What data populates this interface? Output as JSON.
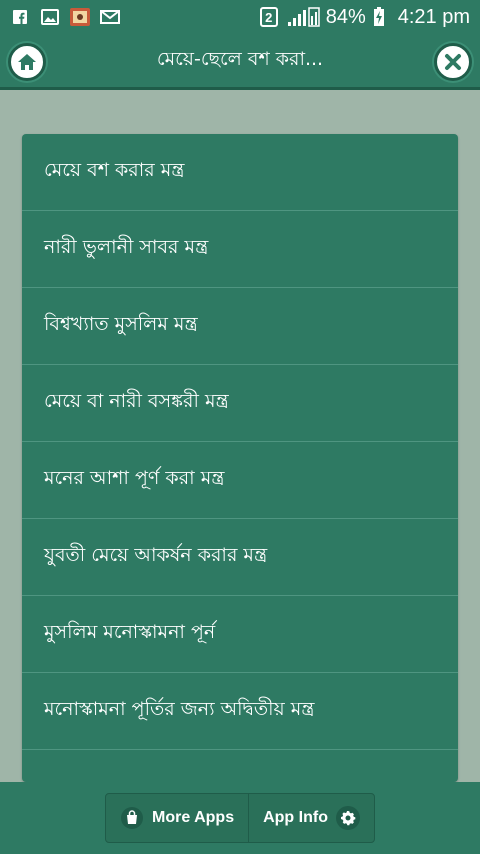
{
  "status_bar": {
    "sim_slot": "2",
    "battery": "84%",
    "time": "4:21 pm",
    "icons": [
      "facebook-icon",
      "gallery-icon",
      "app-icon",
      "mail-icon"
    ]
  },
  "header": {
    "title": "মেয়ে-ছেলে বশ করা...",
    "home_icon": "home-icon",
    "close_icon": "close-icon"
  },
  "menu": {
    "items": [
      {
        "label": "মেয়ে বশ করার মন্ত্র"
      },
      {
        "label": "নারী ভুলানী সাবর মন্ত্র"
      },
      {
        "label": "বিশ্বখ্যাত মুসলিম মন্ত্র"
      },
      {
        "label": "মেয়ে বা নারী বসঙ্করী মন্ত্র"
      },
      {
        "label": "মনের আশা পূর্ণ করা মন্ত্র"
      },
      {
        "label": "যুবতী মেয়ে আকর্ষন করার মন্ত্র"
      },
      {
        "label": "মুসলিম মনোস্কামনা পূর্ন"
      },
      {
        "label": "মনোস্কামনা পূর্তির জন্য অদ্বিতীয় মন্ত্র"
      }
    ]
  },
  "footer": {
    "more_apps_label": "More Apps",
    "app_info_label": "App Info"
  },
  "colors": {
    "primary": "#2e7a63",
    "background": "#9fb5a8",
    "divider": "#4f9581"
  }
}
